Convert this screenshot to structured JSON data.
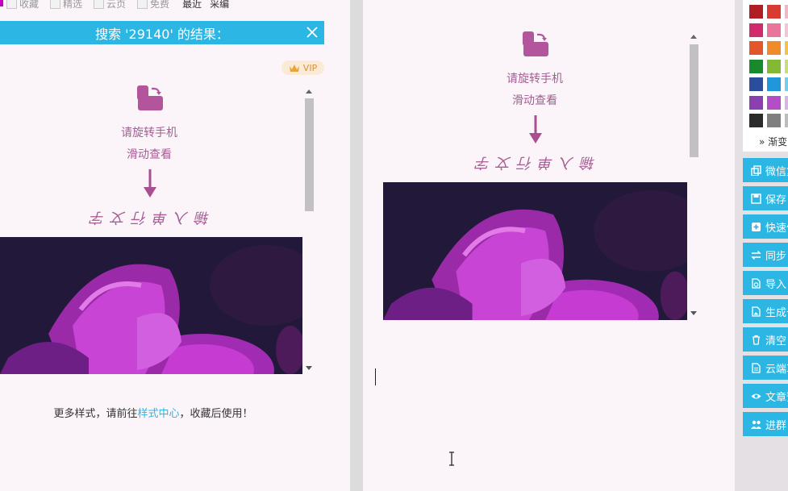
{
  "top_tabs": {
    "tab1": "收藏",
    "tab2": "精选",
    "tab3": "云页",
    "tab4": "免费",
    "recent": "最近",
    "collect": "采编"
  },
  "search": {
    "title": "搜索 '29140' 的结果："
  },
  "vip_label": "VIP",
  "style_card": {
    "rotate_line1": "请旋转手机",
    "rotate_line2": "滑动查看",
    "subtitle": "输入单行文字"
  },
  "footer": {
    "prefix": "更多样式，请前往",
    "link": "样式中心",
    "suffix": "，收藏后使用！"
  },
  "colors": {
    "accent": "#2bb6e3",
    "text_purple": "#a65d92",
    "swatches": [
      "#b01e24",
      "#d93a32",
      "#f2b6c6",
      "#d12b6e",
      "#e9769a",
      "#f3c5d7",
      "#e3552a",
      "#f08a2a",
      "#f2c347",
      "#18892c",
      "#83b935",
      "#c8de7a",
      "#2a4d9e",
      "#2096db",
      "#76cdea",
      "#8c3fb0",
      "#b24fc7",
      "#d6b6e3",
      "#2b2b2b",
      "#7f7f7f",
      "#bdbdbd"
    ]
  },
  "gradient_label": "渐变",
  "sidebar_buttons": [
    {
      "icon": "copy-icon",
      "label": "微信复制"
    },
    {
      "icon": "save-icon",
      "label": "保存"
    },
    {
      "icon": "plus-icon",
      "label": "快速保存"
    },
    {
      "icon": "sync-icon",
      "label": "同步"
    },
    {
      "icon": "import-icon",
      "label": "导入"
    },
    {
      "icon": "image-icon",
      "label": "生成长图"
    },
    {
      "icon": "trash-icon",
      "label": "清空"
    },
    {
      "icon": "document-icon",
      "label": "云端草稿"
    },
    {
      "icon": "eye-icon",
      "label": "文章预览"
    },
    {
      "icon": "users-icon",
      "label": "进群"
    }
  ]
}
